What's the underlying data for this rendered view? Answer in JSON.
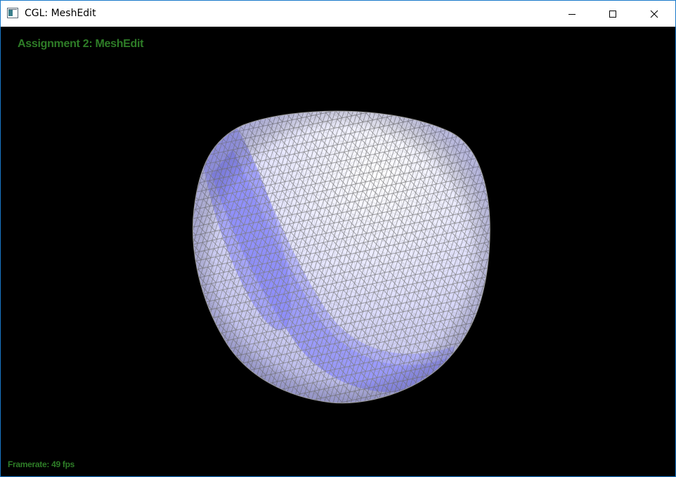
{
  "window": {
    "title": "CGL: MeshEdit"
  },
  "viewport": {
    "assignment_title": "Assignment 2: MeshEdit",
    "framerate_prefix": "Framerate:",
    "framerate_value": "49",
    "framerate_unit": "fps"
  },
  "icons": {
    "app": "app-window-icon",
    "minimize": "minimize-icon",
    "maximize": "maximize-icon",
    "close": "close-icon"
  },
  "colors": {
    "overlay_text": "#2e7d27",
    "mesh_fill_light": "#ffffff",
    "mesh_fill_shade": "#8c8cff",
    "mesh_wire": "#8a8a8a",
    "background": "#000000",
    "window_border": "#1979ca"
  }
}
